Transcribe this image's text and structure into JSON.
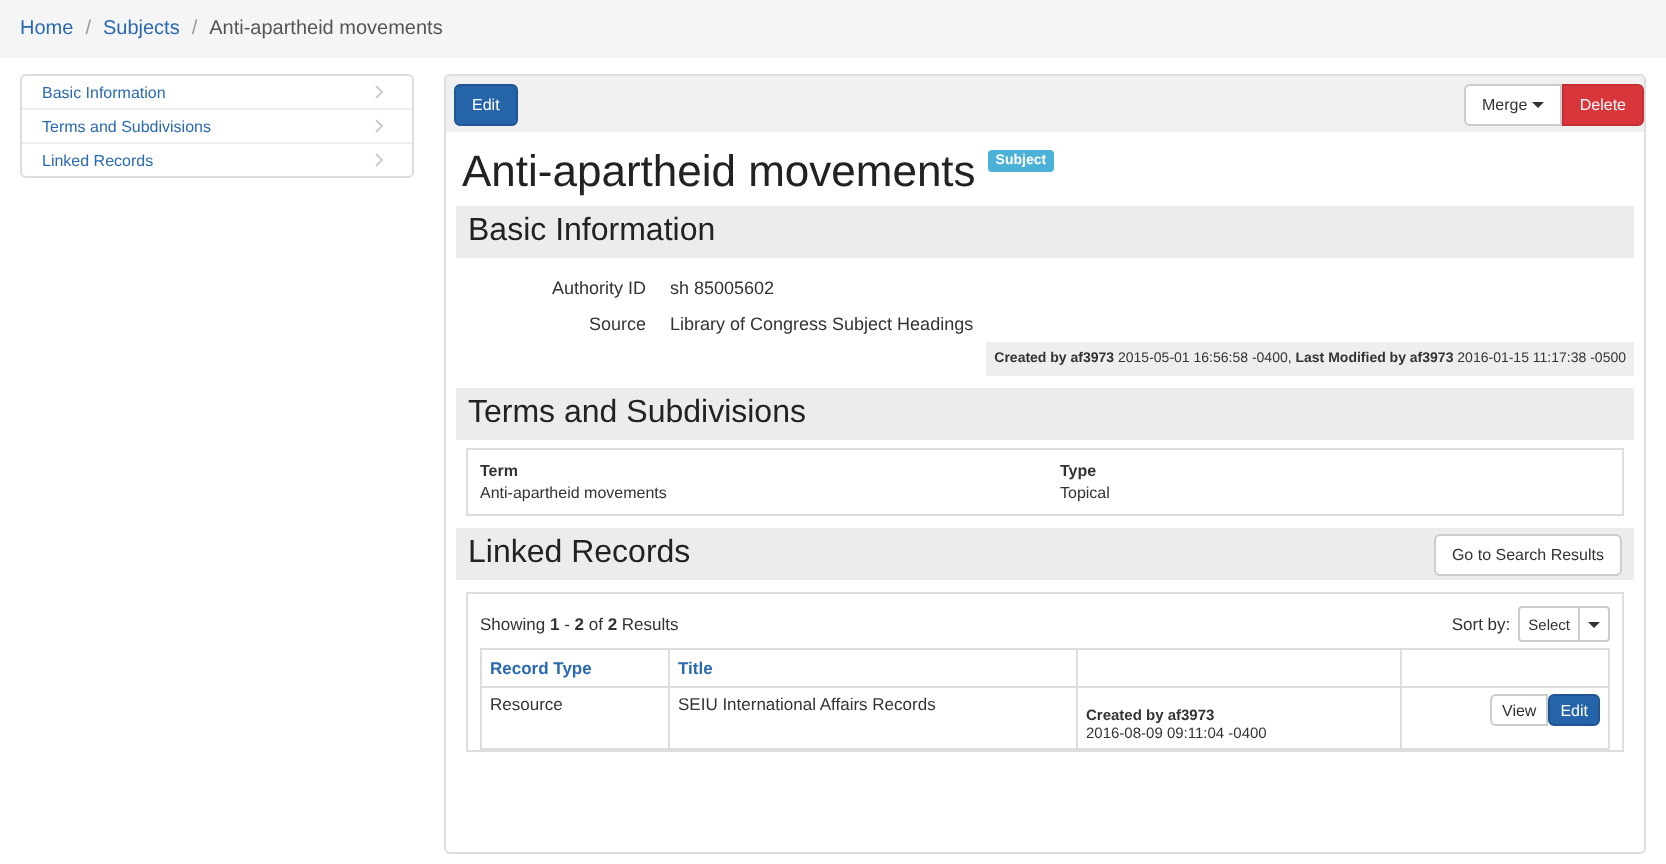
{
  "breadcrumb": [
    "Home",
    "Subjects",
    "Anti-apartheid movements"
  ],
  "breadcrumb_separator": "/",
  "sidebar": {
    "items": [
      {
        "label": "Basic Information"
      },
      {
        "label": "Terms and Subdivisions"
      },
      {
        "label": "Linked Records"
      }
    ]
  },
  "toolbar": {
    "edit": "Edit",
    "merge": "Merge",
    "delete": "Delete"
  },
  "title": "Anti-apartheid movements",
  "badge": "Subject",
  "basic_information": {
    "heading": "Basic Information",
    "fields": [
      {
        "label": "Authority ID",
        "value": "sh 85005602"
      },
      {
        "label": "Source",
        "value": "Library of Congress Subject Headings"
      }
    ],
    "audit": "**Created by af3973** 2015-05-01 16:56:58 -0400, **Last Modified by af3973** 2016-01-15 11:17:38 -0500"
  },
  "terms": {
    "heading": "Terms and Subdivisions",
    "columns": [
      "Term",
      "Type"
    ],
    "rows": [
      [
        "Anti-apartheid movements",
        "Topical"
      ]
    ]
  },
  "linked_records": {
    "heading": "Linked Records",
    "search_button": "Go to Search Results",
    "summary": "Showing **1** - **2** of **2** Results",
    "sort_label": "Sort by:",
    "sort_value": "Select",
    "columns": [
      "Record Type",
      "Title"
    ],
    "rows": [
      {
        "type": "Resource",
        "title": "SEIU International Affairs Records",
        "created": "Created by af3973",
        "date": "2016-08-09 09:11:04 -0400",
        "actions": [
          "View",
          "Edit"
        ]
      }
    ]
  }
}
